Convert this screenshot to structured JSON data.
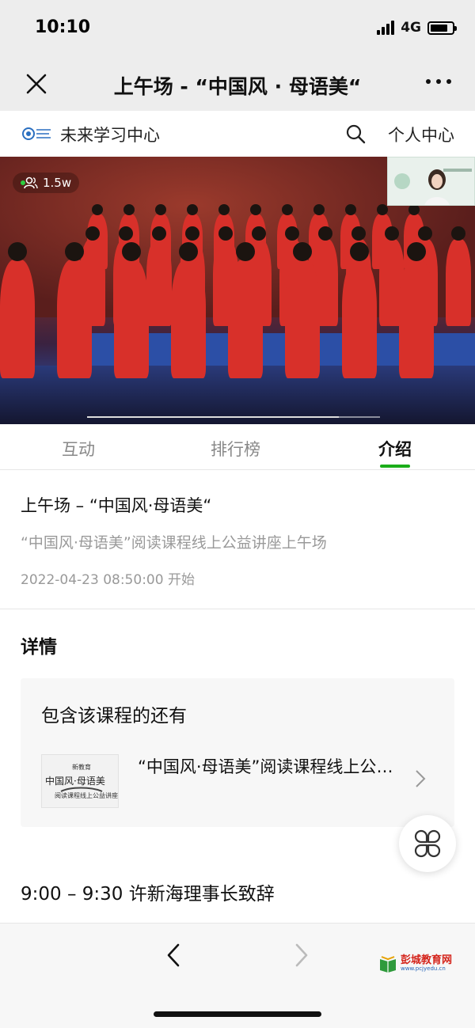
{
  "status_bar": {
    "time": "10:10",
    "network": "4G",
    "battery_level": 0.8
  },
  "nav": {
    "title": "上午场 - “中国风 · 母语美“",
    "close_icon": "close-icon",
    "more_icon": "more-dots-icon"
  },
  "site_header": {
    "logo_icon": "new-education-logo",
    "site_name": "未来学习中心",
    "search_icon": "search-icon",
    "profile_link": "个人中心"
  },
  "video": {
    "viewer_icon": "people-icon",
    "viewer_count": "1.5w",
    "playback_progress": 0.86
  },
  "tabs": [
    {
      "label": "互动",
      "active": false
    },
    {
      "label": "排行榜",
      "active": false
    },
    {
      "label": "介绍",
      "active": true
    }
  ],
  "intro": {
    "title": "上午场 – “中国风·母语美“",
    "subtitle": "“中国风·母语美”阅读课程线上公益讲座上午场",
    "start_time": "2022-04-23 08:50:00 开始"
  },
  "details": {
    "heading": "详情",
    "related_heading": "包含该课程的还有",
    "related_course": {
      "title": "“中国风·母语美”阅读课程线上公益讲座",
      "thumb_top": "新教育",
      "thumb_main": "中国风·母语美",
      "thumb_sub": "阅读课程线上公益讲座"
    },
    "schedule_line": "9:00 – 9:30 许新海理事长致辞"
  },
  "floating_button_icon": "grid-menu-icon",
  "bottom_bar": {
    "back_icon": "back-arrow-icon",
    "forward_icon": "forward-arrow-icon"
  },
  "watermark": {
    "name": "彭城教育网",
    "url": "www.pcjyedu.cn"
  },
  "colors": {
    "accent": "#1aad19",
    "nav_bg": "#ededed",
    "video_red": "#d8302a",
    "watermark_red": "#d4241b"
  }
}
